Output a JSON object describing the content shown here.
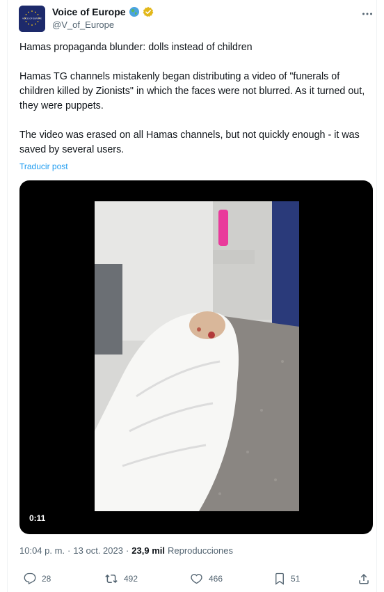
{
  "account": {
    "display_name": "Voice of Europe",
    "handle": "@V_of_Europe",
    "avatar_text": "VOICE OF EUROPE"
  },
  "tweet": {
    "paragraphs": [
      "Hamas propaganda blunder: dolls instead of children",
      "Hamas TG channels mistakenly began distributing a video of \"funerals of children killed by Zionists\" in which the faces were not blurred. As it turned out, they were puppets.",
      "The video was erased on all Hamas channels, but not quickly enough - it was saved by several users."
    ],
    "translate_label": "Traducir post"
  },
  "media": {
    "duration": "0:11"
  },
  "meta": {
    "time": "10:04 p. m.",
    "separator1": "·",
    "date": "13 oct. 2023",
    "separator2": "·",
    "views_count": "23,9 mil",
    "views_label": "Reproducciones"
  },
  "actions": {
    "replies": "28",
    "reposts": "492",
    "likes": "466",
    "bookmarks": "51"
  },
  "colors": {
    "accent": "#1d9bf0",
    "secondary_text": "#536471",
    "verified_gold": "#e2b719"
  },
  "icons": [
    "globe-icon",
    "verified-badge-icon",
    "more-icon",
    "reply-icon",
    "repost-icon",
    "like-icon",
    "bookmark-icon",
    "share-icon"
  ]
}
